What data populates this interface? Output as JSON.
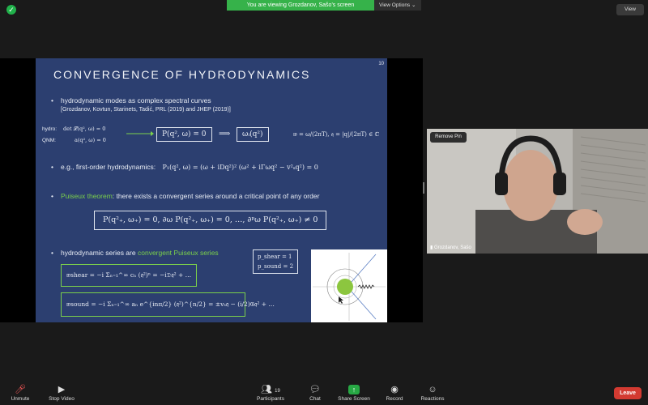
{
  "topbar": {
    "viewing": "You are viewing Grozdanov, Sašo's screen",
    "view_options": "View Options ⌄",
    "view": "View"
  },
  "slide": {
    "page_number": "10",
    "title": "CONVERGENCE OF HYDRODYNAMICS",
    "bullet1": "hydrodynamic modes as complex spectral curves",
    "ref1": "[Grozdanov, Kovtun, Starinets, Tadić, PRL (2019) and JHEP (2019)]",
    "hydro_label": "hydro:",
    "hydro_eq": "det 𝓛(q², ω) = 0",
    "qnm_label": "QNM:",
    "qnm_eq": "a(q², ω) = 0",
    "box_eq1": "P(q², ω) = 0",
    "implies": "⟹",
    "box_eq2": "ωᵢ(q²)",
    "frak_eq": "𝔴 = ω/(2πT),  𝔮 = |q|/(2πT) ∈ ℂ",
    "bullet2_label": "e.g., first-order hydrodynamics:",
    "bullet2_eq": "P₁(q², ω) = (ω + iDq²)² (ω² + iΓωq² − v²ₛq²) = 0",
    "puiseux_word": "Puiseux theorem",
    "bullet3_rest": ": there exists a convergent series around a critical point of any order",
    "box_eq3": "P(q²₊, ω₊) = 0,  ∂ω P(q²₊, ω₊) = 0, …, ∂ᵖω P(q²₊, ω₊) ≠ 0",
    "bullet4_pre": "hydrodynamic series are",
    "bullet4_green": "convergent Puiseux series",
    "p_shear": "p_shear = 1",
    "p_sound": "p_sound = 2",
    "series_shear": "𝔴shear = −i Σₙ₌₁^∞ cₙ (𝔮²)ⁿ = −i𝔇𝔮² + …",
    "series_sound": "𝔴sound = −i Σₙ₌₁^∞ aₙ e^{inπ/2} (𝔮²)^{n/2} = ±vₛ𝔮 − (i/2)𝔊𝔮² + …"
  },
  "video": {
    "remove_pin": "Remove Pin",
    "name": "Grozdanov, Sašo"
  },
  "toolbar": {
    "unmute": "Unmute",
    "stop_video": "Stop Video",
    "participants": "Participants",
    "participants_count": "19",
    "chat": "Chat",
    "share_screen": "Share Screen",
    "record": "Record",
    "reactions": "Reactions",
    "leave": "Leave"
  }
}
